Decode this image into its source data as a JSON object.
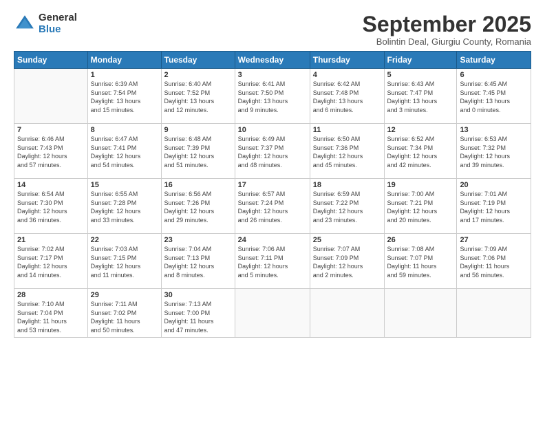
{
  "header": {
    "logo_general": "General",
    "logo_blue": "Blue",
    "month_title": "September 2025",
    "location": "Bolintin Deal, Giurgiu County, Romania"
  },
  "weekdays": [
    "Sunday",
    "Monday",
    "Tuesday",
    "Wednesday",
    "Thursday",
    "Friday",
    "Saturday"
  ],
  "weeks": [
    [
      {
        "day": "",
        "info": ""
      },
      {
        "day": "1",
        "info": "Sunrise: 6:39 AM\nSunset: 7:54 PM\nDaylight: 13 hours\nand 15 minutes."
      },
      {
        "day": "2",
        "info": "Sunrise: 6:40 AM\nSunset: 7:52 PM\nDaylight: 13 hours\nand 12 minutes."
      },
      {
        "day": "3",
        "info": "Sunrise: 6:41 AM\nSunset: 7:50 PM\nDaylight: 13 hours\nand 9 minutes."
      },
      {
        "day": "4",
        "info": "Sunrise: 6:42 AM\nSunset: 7:48 PM\nDaylight: 13 hours\nand 6 minutes."
      },
      {
        "day": "5",
        "info": "Sunrise: 6:43 AM\nSunset: 7:47 PM\nDaylight: 13 hours\nand 3 minutes."
      },
      {
        "day": "6",
        "info": "Sunrise: 6:45 AM\nSunset: 7:45 PM\nDaylight: 13 hours\nand 0 minutes."
      }
    ],
    [
      {
        "day": "7",
        "info": "Sunrise: 6:46 AM\nSunset: 7:43 PM\nDaylight: 12 hours\nand 57 minutes."
      },
      {
        "day": "8",
        "info": "Sunrise: 6:47 AM\nSunset: 7:41 PM\nDaylight: 12 hours\nand 54 minutes."
      },
      {
        "day": "9",
        "info": "Sunrise: 6:48 AM\nSunset: 7:39 PM\nDaylight: 12 hours\nand 51 minutes."
      },
      {
        "day": "10",
        "info": "Sunrise: 6:49 AM\nSunset: 7:37 PM\nDaylight: 12 hours\nand 48 minutes."
      },
      {
        "day": "11",
        "info": "Sunrise: 6:50 AM\nSunset: 7:36 PM\nDaylight: 12 hours\nand 45 minutes."
      },
      {
        "day": "12",
        "info": "Sunrise: 6:52 AM\nSunset: 7:34 PM\nDaylight: 12 hours\nand 42 minutes."
      },
      {
        "day": "13",
        "info": "Sunrise: 6:53 AM\nSunset: 7:32 PM\nDaylight: 12 hours\nand 39 minutes."
      }
    ],
    [
      {
        "day": "14",
        "info": "Sunrise: 6:54 AM\nSunset: 7:30 PM\nDaylight: 12 hours\nand 36 minutes."
      },
      {
        "day": "15",
        "info": "Sunrise: 6:55 AM\nSunset: 7:28 PM\nDaylight: 12 hours\nand 33 minutes."
      },
      {
        "day": "16",
        "info": "Sunrise: 6:56 AM\nSunset: 7:26 PM\nDaylight: 12 hours\nand 29 minutes."
      },
      {
        "day": "17",
        "info": "Sunrise: 6:57 AM\nSunset: 7:24 PM\nDaylight: 12 hours\nand 26 minutes."
      },
      {
        "day": "18",
        "info": "Sunrise: 6:59 AM\nSunset: 7:22 PM\nDaylight: 12 hours\nand 23 minutes."
      },
      {
        "day": "19",
        "info": "Sunrise: 7:00 AM\nSunset: 7:21 PM\nDaylight: 12 hours\nand 20 minutes."
      },
      {
        "day": "20",
        "info": "Sunrise: 7:01 AM\nSunset: 7:19 PM\nDaylight: 12 hours\nand 17 minutes."
      }
    ],
    [
      {
        "day": "21",
        "info": "Sunrise: 7:02 AM\nSunset: 7:17 PM\nDaylight: 12 hours\nand 14 minutes."
      },
      {
        "day": "22",
        "info": "Sunrise: 7:03 AM\nSunset: 7:15 PM\nDaylight: 12 hours\nand 11 minutes."
      },
      {
        "day": "23",
        "info": "Sunrise: 7:04 AM\nSunset: 7:13 PM\nDaylight: 12 hours\nand 8 minutes."
      },
      {
        "day": "24",
        "info": "Sunrise: 7:06 AM\nSunset: 7:11 PM\nDaylight: 12 hours\nand 5 minutes."
      },
      {
        "day": "25",
        "info": "Sunrise: 7:07 AM\nSunset: 7:09 PM\nDaylight: 12 hours\nand 2 minutes."
      },
      {
        "day": "26",
        "info": "Sunrise: 7:08 AM\nSunset: 7:07 PM\nDaylight: 11 hours\nand 59 minutes."
      },
      {
        "day": "27",
        "info": "Sunrise: 7:09 AM\nSunset: 7:06 PM\nDaylight: 11 hours\nand 56 minutes."
      }
    ],
    [
      {
        "day": "28",
        "info": "Sunrise: 7:10 AM\nSunset: 7:04 PM\nDaylight: 11 hours\nand 53 minutes."
      },
      {
        "day": "29",
        "info": "Sunrise: 7:11 AM\nSunset: 7:02 PM\nDaylight: 11 hours\nand 50 minutes."
      },
      {
        "day": "30",
        "info": "Sunrise: 7:13 AM\nSunset: 7:00 PM\nDaylight: 11 hours\nand 47 minutes."
      },
      {
        "day": "",
        "info": ""
      },
      {
        "day": "",
        "info": ""
      },
      {
        "day": "",
        "info": ""
      },
      {
        "day": "",
        "info": ""
      }
    ]
  ]
}
